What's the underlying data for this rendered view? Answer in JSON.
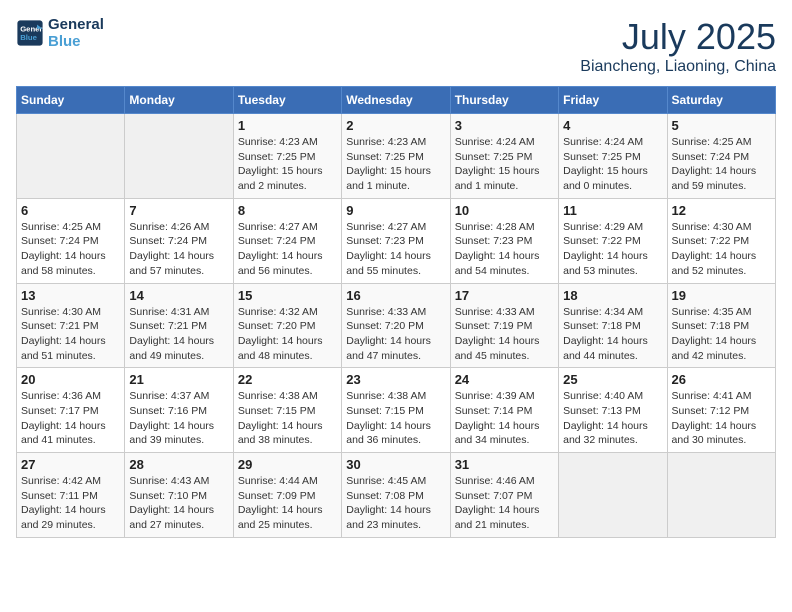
{
  "header": {
    "logo_line1": "General",
    "logo_line2": "Blue",
    "month_title": "July 2025",
    "location": "Biancheng, Liaoning, China"
  },
  "weekdays": [
    "Sunday",
    "Monday",
    "Tuesday",
    "Wednesday",
    "Thursday",
    "Friday",
    "Saturday"
  ],
  "weeks": [
    [
      {
        "day": "",
        "info": ""
      },
      {
        "day": "",
        "info": ""
      },
      {
        "day": "1",
        "info": "Sunrise: 4:23 AM\nSunset: 7:25 PM\nDaylight: 15 hours\nand 2 minutes."
      },
      {
        "day": "2",
        "info": "Sunrise: 4:23 AM\nSunset: 7:25 PM\nDaylight: 15 hours\nand 1 minute."
      },
      {
        "day": "3",
        "info": "Sunrise: 4:24 AM\nSunset: 7:25 PM\nDaylight: 15 hours\nand 1 minute."
      },
      {
        "day": "4",
        "info": "Sunrise: 4:24 AM\nSunset: 7:25 PM\nDaylight: 15 hours\nand 0 minutes."
      },
      {
        "day": "5",
        "info": "Sunrise: 4:25 AM\nSunset: 7:24 PM\nDaylight: 14 hours\nand 59 minutes."
      }
    ],
    [
      {
        "day": "6",
        "info": "Sunrise: 4:25 AM\nSunset: 7:24 PM\nDaylight: 14 hours\nand 58 minutes."
      },
      {
        "day": "7",
        "info": "Sunrise: 4:26 AM\nSunset: 7:24 PM\nDaylight: 14 hours\nand 57 minutes."
      },
      {
        "day": "8",
        "info": "Sunrise: 4:27 AM\nSunset: 7:24 PM\nDaylight: 14 hours\nand 56 minutes."
      },
      {
        "day": "9",
        "info": "Sunrise: 4:27 AM\nSunset: 7:23 PM\nDaylight: 14 hours\nand 55 minutes."
      },
      {
        "day": "10",
        "info": "Sunrise: 4:28 AM\nSunset: 7:23 PM\nDaylight: 14 hours\nand 54 minutes."
      },
      {
        "day": "11",
        "info": "Sunrise: 4:29 AM\nSunset: 7:22 PM\nDaylight: 14 hours\nand 53 minutes."
      },
      {
        "day": "12",
        "info": "Sunrise: 4:30 AM\nSunset: 7:22 PM\nDaylight: 14 hours\nand 52 minutes."
      }
    ],
    [
      {
        "day": "13",
        "info": "Sunrise: 4:30 AM\nSunset: 7:21 PM\nDaylight: 14 hours\nand 51 minutes."
      },
      {
        "day": "14",
        "info": "Sunrise: 4:31 AM\nSunset: 7:21 PM\nDaylight: 14 hours\nand 49 minutes."
      },
      {
        "day": "15",
        "info": "Sunrise: 4:32 AM\nSunset: 7:20 PM\nDaylight: 14 hours\nand 48 minutes."
      },
      {
        "day": "16",
        "info": "Sunrise: 4:33 AM\nSunset: 7:20 PM\nDaylight: 14 hours\nand 47 minutes."
      },
      {
        "day": "17",
        "info": "Sunrise: 4:33 AM\nSunset: 7:19 PM\nDaylight: 14 hours\nand 45 minutes."
      },
      {
        "day": "18",
        "info": "Sunrise: 4:34 AM\nSunset: 7:18 PM\nDaylight: 14 hours\nand 44 minutes."
      },
      {
        "day": "19",
        "info": "Sunrise: 4:35 AM\nSunset: 7:18 PM\nDaylight: 14 hours\nand 42 minutes."
      }
    ],
    [
      {
        "day": "20",
        "info": "Sunrise: 4:36 AM\nSunset: 7:17 PM\nDaylight: 14 hours\nand 41 minutes."
      },
      {
        "day": "21",
        "info": "Sunrise: 4:37 AM\nSunset: 7:16 PM\nDaylight: 14 hours\nand 39 minutes."
      },
      {
        "day": "22",
        "info": "Sunrise: 4:38 AM\nSunset: 7:15 PM\nDaylight: 14 hours\nand 38 minutes."
      },
      {
        "day": "23",
        "info": "Sunrise: 4:38 AM\nSunset: 7:15 PM\nDaylight: 14 hours\nand 36 minutes."
      },
      {
        "day": "24",
        "info": "Sunrise: 4:39 AM\nSunset: 7:14 PM\nDaylight: 14 hours\nand 34 minutes."
      },
      {
        "day": "25",
        "info": "Sunrise: 4:40 AM\nSunset: 7:13 PM\nDaylight: 14 hours\nand 32 minutes."
      },
      {
        "day": "26",
        "info": "Sunrise: 4:41 AM\nSunset: 7:12 PM\nDaylight: 14 hours\nand 30 minutes."
      }
    ],
    [
      {
        "day": "27",
        "info": "Sunrise: 4:42 AM\nSunset: 7:11 PM\nDaylight: 14 hours\nand 29 minutes."
      },
      {
        "day": "28",
        "info": "Sunrise: 4:43 AM\nSunset: 7:10 PM\nDaylight: 14 hours\nand 27 minutes."
      },
      {
        "day": "29",
        "info": "Sunrise: 4:44 AM\nSunset: 7:09 PM\nDaylight: 14 hours\nand 25 minutes."
      },
      {
        "day": "30",
        "info": "Sunrise: 4:45 AM\nSunset: 7:08 PM\nDaylight: 14 hours\nand 23 minutes."
      },
      {
        "day": "31",
        "info": "Sunrise: 4:46 AM\nSunset: 7:07 PM\nDaylight: 14 hours\nand 21 minutes."
      },
      {
        "day": "",
        "info": ""
      },
      {
        "day": "",
        "info": ""
      }
    ]
  ]
}
